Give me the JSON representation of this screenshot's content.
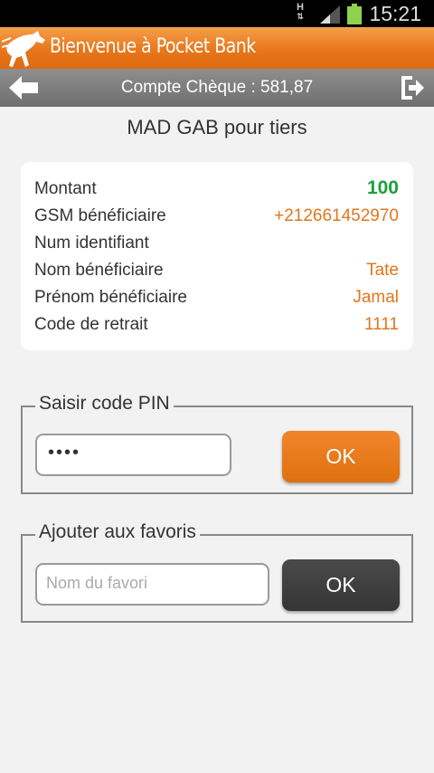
{
  "status_bar": {
    "network": "H",
    "time": "15:21"
  },
  "header": {
    "title": "Bienvenue à Pocket Bank"
  },
  "account_bar": {
    "account": "Compte Chèque : 581,87"
  },
  "page": {
    "title": "MAD GAB pour tiers"
  },
  "summary": [
    {
      "label": "Montant",
      "value": "100"
    },
    {
      "label": "GSM bénéficiaire",
      "value": "+212661452970"
    },
    {
      "label": "Num identifiant",
      "value": ""
    },
    {
      "label": "Nom bénéficiaire",
      "value": "Tate"
    },
    {
      "label": "Prénom bénéficiaire",
      "value": "Jamal"
    },
    {
      "label": "Code de retrait",
      "value": "1111"
    }
  ],
  "pin_section": {
    "legend": "Saisir code PIN",
    "value": "••••",
    "button": "OK"
  },
  "favorites_section": {
    "legend": "Ajouter aux favoris",
    "placeholder": "Nom du favori",
    "button": "OK"
  },
  "colors": {
    "brand_orange": "#e8761a",
    "amount_green": "#1aa03a",
    "value_orange": "#e0761e",
    "dark_button": "#3a3a3a"
  },
  "icons": [
    "signal-icon",
    "battery-icon",
    "horse-logo-icon",
    "back-arrow-icon",
    "logout-icon"
  ]
}
